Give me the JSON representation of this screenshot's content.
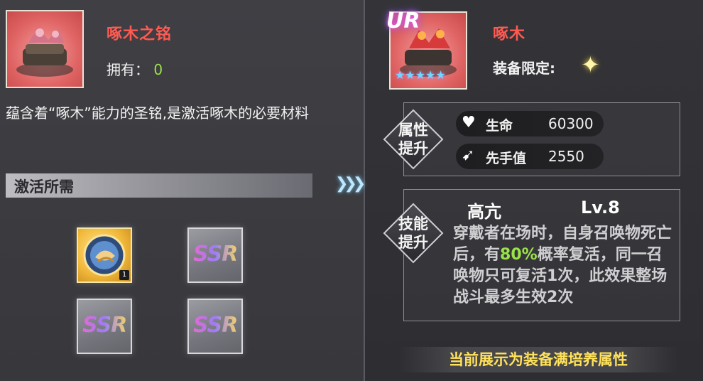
{
  "left": {
    "item_name": "啄木之铭",
    "owned_label": "拥有：",
    "owned_value": "0",
    "description": "蕴含着“啄木”能力的圣铭,是激活啄木的必要材料",
    "section_title": "激活所需",
    "materials": [
      {
        "type": "gold-orb",
        "count": "1"
      },
      {
        "type": "SSR",
        "label": "SSR"
      },
      {
        "type": "SSR",
        "label": "SSR"
      },
      {
        "type": "SSR",
        "label": "SSR"
      }
    ]
  },
  "right": {
    "rarity_badge": "UR",
    "item_name": "啄木",
    "equip_limit_label": "装备限定:",
    "attr_section_label": "属性提升",
    "stats": [
      {
        "icon": "heart-icon",
        "name": "生命",
        "value": "60300"
      },
      {
        "icon": "speed-icon",
        "name": "先手值",
        "value": "2550"
      }
    ],
    "skill_section_label": "技能提升",
    "skill_name": "高亢",
    "skill_level": "Lv.8",
    "skill_desc_parts": [
      "穿戴者在场时，自身召唤物死亡后，有",
      "80%",
      "概率复活，同一召唤物只可复活1次，此效果整场战斗最多生效2次"
    ],
    "footer": "当前展示为装备满培养属性"
  }
}
